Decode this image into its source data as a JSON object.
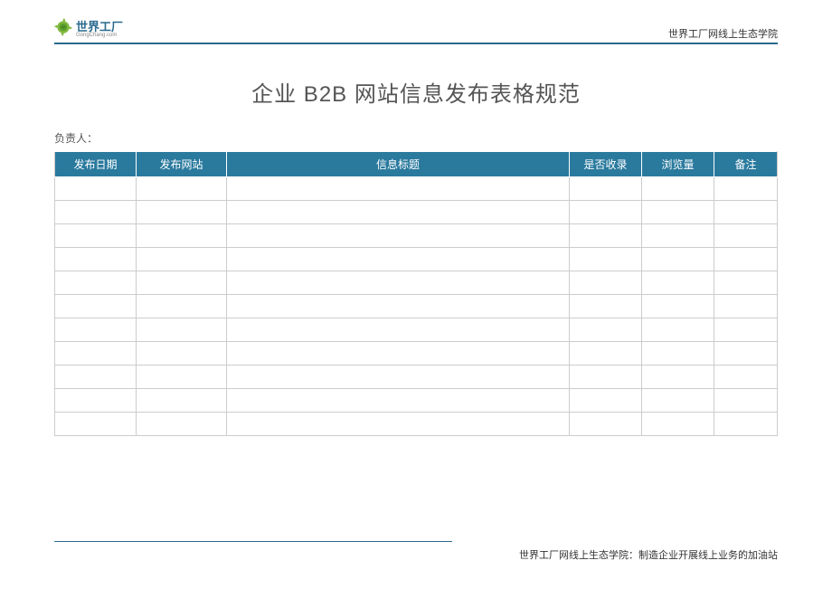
{
  "header": {
    "logo_main": "世界工厂",
    "logo_sub": "GongChang.com",
    "right_text": "世界工厂网线上生态学院"
  },
  "title": "企业 B2B 网站信息发布表格规范",
  "responsible_label": "负责人：",
  "table": {
    "columns": [
      "发布日期",
      "发布网站",
      "信息标题",
      "是否收录",
      "浏览量",
      "备注"
    ],
    "rows": [
      [
        "",
        "",
        "",
        "",
        "",
        ""
      ],
      [
        "",
        "",
        "",
        "",
        "",
        ""
      ],
      [
        "",
        "",
        "",
        "",
        "",
        ""
      ],
      [
        "",
        "",
        "",
        "",
        "",
        ""
      ],
      [
        "",
        "",
        "",
        "",
        "",
        ""
      ],
      [
        "",
        "",
        "",
        "",
        "",
        ""
      ],
      [
        "",
        "",
        "",
        "",
        "",
        ""
      ],
      [
        "",
        "",
        "",
        "",
        "",
        ""
      ],
      [
        "",
        "",
        "",
        "",
        "",
        ""
      ],
      [
        "",
        "",
        "",
        "",
        "",
        ""
      ],
      [
        "",
        "",
        "",
        "",
        "",
        ""
      ]
    ]
  },
  "footer": "世界工厂网线上生态学院：制造企业开展线上业务的加油站"
}
